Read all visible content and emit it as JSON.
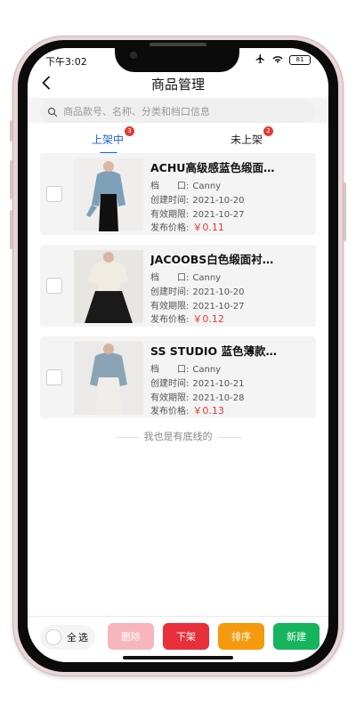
{
  "status": {
    "time": "下午3:02",
    "airplane_icon": "airplane-icon",
    "wifi_icon": "wifi-icon",
    "battery": "81"
  },
  "nav": {
    "title": "商品管理",
    "back_icon": "chevron-left-icon"
  },
  "search": {
    "placeholder": "商品款号、名称、分类和档口信息",
    "icon": "search-icon"
  },
  "tabs": [
    {
      "label": "上架中",
      "badge": "3",
      "active": true
    },
    {
      "label": "未上架",
      "badge": "2",
      "active": false
    }
  ],
  "labels": {
    "stall": "档　　口:",
    "created": "创建时间:",
    "expiry": "有效期限:",
    "price": "发布价格:"
  },
  "products": [
    {
      "name": "ACHU高级感蓝色缎面…",
      "stall": "Canny",
      "created": "2021-10-20",
      "expiry": "2021-10-27",
      "price": "￥0.11"
    },
    {
      "name": "JACOOBS白色缎面衬…",
      "stall": "Canny",
      "created": "2021-10-20",
      "expiry": "2021-10-27",
      "price": "￥0.12"
    },
    {
      "name": "SS STUDIO 蓝色薄款…",
      "stall": "Canny",
      "created": "2021-10-21",
      "expiry": "2021-10-28",
      "price": "￥0.13"
    }
  ],
  "end_text": "我也是有底线的",
  "bottom": {
    "select_all": "全选",
    "buttons": [
      {
        "label": "删除",
        "color": "#f7b6bc"
      },
      {
        "label": "下架",
        "color": "#e8303a"
      },
      {
        "label": "排序",
        "color": "#f59a0d"
      },
      {
        "label": "新建",
        "color": "#17b45e"
      }
    ]
  },
  "colors": {
    "accent": "#1e63c9",
    "price": "#e53935",
    "badge": "#e53935"
  }
}
